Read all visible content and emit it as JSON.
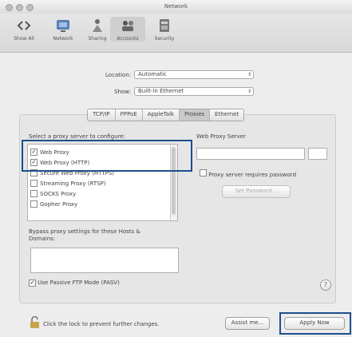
{
  "window": {
    "title": "Network"
  },
  "toolbar": {
    "items": [
      {
        "label": "Show All",
        "icon": "back-forward-icon"
      },
      {
        "label": "Network",
        "icon": "network-icon"
      },
      {
        "label": "Sharing",
        "icon": "sharing-icon"
      },
      {
        "label": "Accounts",
        "icon": "accounts-icon"
      },
      {
        "label": "Security",
        "icon": "security-icon"
      }
    ]
  },
  "location": {
    "label": "Location:",
    "value": "Automatic"
  },
  "show": {
    "label": "Show:",
    "value": "Built-in Ethernet"
  },
  "tabs": [
    "TCP/IP",
    "PPPoE",
    "AppleTalk",
    "Proxies",
    "Ethernet"
  ],
  "proxies": {
    "section_label": "Select a proxy server to configure:",
    "items": [
      {
        "label": "Web Proxy",
        "checked": true
      },
      {
        "label": "Web Proxy (HTTP)",
        "checked": true
      },
      {
        "label": "Secure Web Proxy (HTTPS)",
        "checked": false
      },
      {
        "label": "Streaming Proxy (RTSP)",
        "checked": false
      },
      {
        "label": "SOCKS Proxy",
        "checked": false
      },
      {
        "label": "Gopher Proxy",
        "checked": false
      }
    ],
    "server_label": "Web Proxy Server",
    "password_label": "Proxy server requires password",
    "set_password_button": "Set Password...",
    "bypass_label": "Bypass proxy settings for these Hosts & Domains:",
    "passive_ftp_label": "Use Passive FTP Mode (PASV)"
  },
  "footer": {
    "lock_text": "Click the lock to prevent further changes.",
    "assist_button": "Assist me...",
    "apply_button": "Apply Now",
    "help": "?"
  },
  "colors": {
    "highlight": "#1c4f8c"
  }
}
